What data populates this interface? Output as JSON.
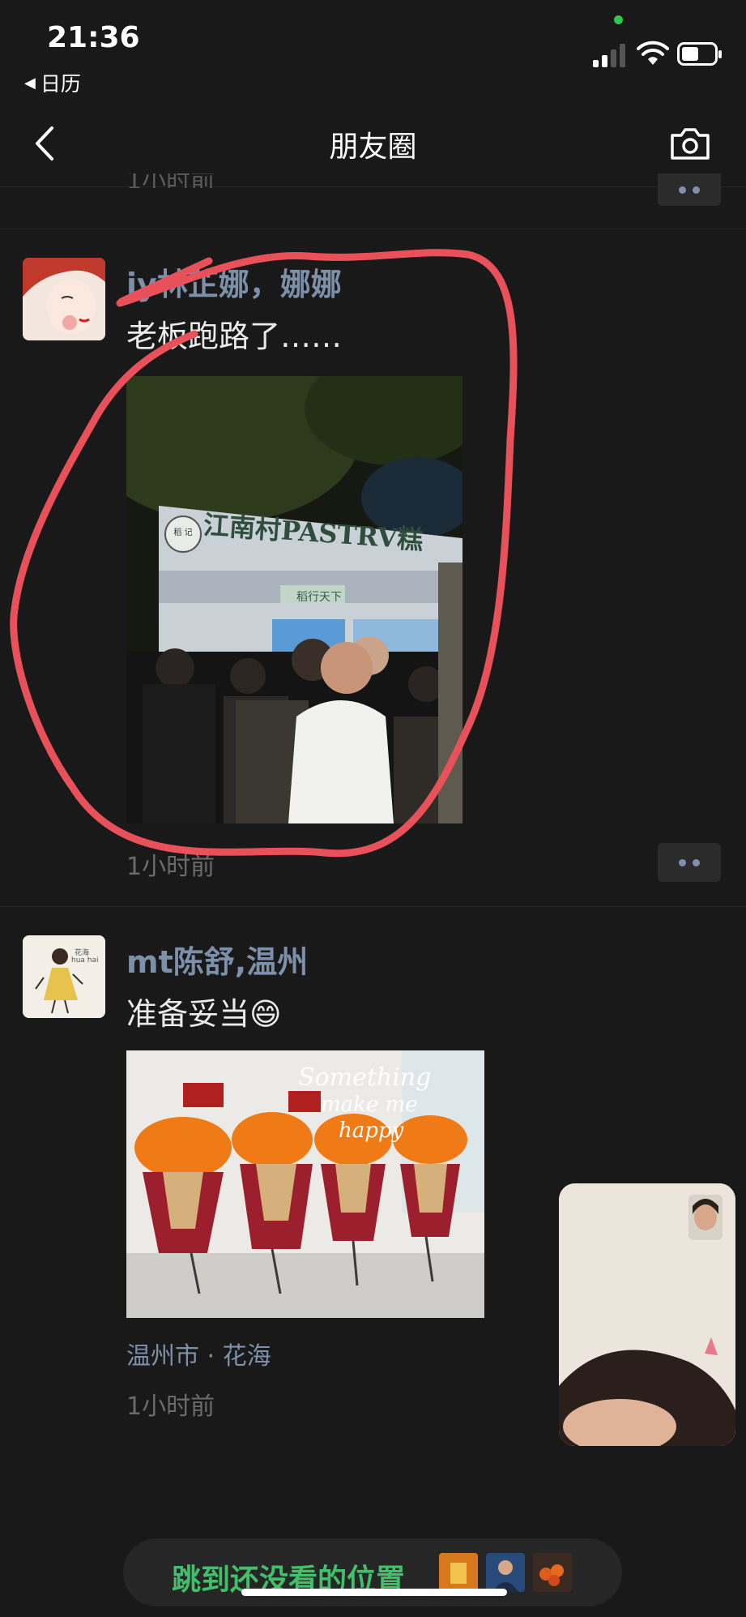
{
  "status": {
    "time": "21:36",
    "back_app": "日历"
  },
  "nav": {
    "title": "朋友圈"
  },
  "prev_post": {
    "time": "1小时前"
  },
  "posts": [
    {
      "username": "jy林芷娜，娜娜",
      "text": "老板跑路了……",
      "time": "1小时前",
      "photo_sign": "江南村PASTRV糕",
      "photo_plaque": "稻行天下",
      "photo_logo": "稻 记"
    },
    {
      "username": "mt陈舒,温州",
      "text": "准备妥当",
      "emoji": "😄",
      "location": "温州市 · 花海",
      "time": "1小时前",
      "photo_overlay_1": "Something",
      "photo_overlay_2": "make me",
      "photo_overlay_3": "happy",
      "avatar_text_1": "花海",
      "avatar_text_2": "hua hai"
    }
  ],
  "jump": {
    "label": "跳到还没看的位置"
  },
  "colors": {
    "background": "#191919",
    "username": "#7d90a9",
    "accent_green": "#3fc069",
    "annotation": "#e8505a"
  }
}
